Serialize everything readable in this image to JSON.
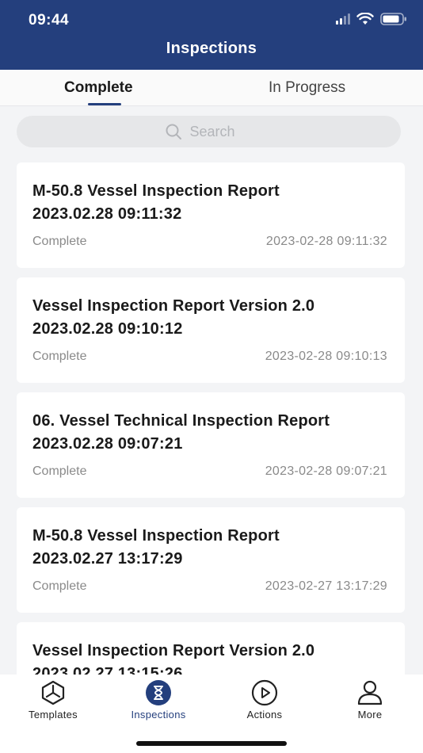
{
  "status_bar": {
    "time": "09:44"
  },
  "header": {
    "title": "Inspections"
  },
  "tabs": [
    {
      "label": "Complete",
      "active": true
    },
    {
      "label": "In Progress",
      "active": false
    }
  ],
  "search": {
    "placeholder": "Search"
  },
  "inspections": [
    {
      "title_line1": "M-50.8 Vessel Inspection Report",
      "title_line2": "2023.02.28 09:11:32",
      "status": "Complete",
      "date": "2023-02-28 09:11:32"
    },
    {
      "title_line1": "Vessel Inspection Report Version 2.0",
      "title_line2": "2023.02.28 09:10:12",
      "status": "Complete",
      "date": "2023-02-28 09:10:13"
    },
    {
      "title_line1": "06. Vessel Technical Inspection Report",
      "title_line2": "2023.02.28 09:07:21",
      "status": "Complete",
      "date": "2023-02-28 09:07:21"
    },
    {
      "title_line1": "M-50.8 Vessel Inspection Report",
      "title_line2": "2023.02.27 13:17:29",
      "status": "Complete",
      "date": "2023-02-27 13:17:29"
    },
    {
      "title_line1": "Vessel Inspection Report Version 2.0",
      "title_line2": "2023.02.27 13:15:26",
      "status": "",
      "date": ""
    }
  ],
  "bottom_nav": [
    {
      "label": "Templates",
      "icon": "templates-icon",
      "active": false
    },
    {
      "label": "Inspections",
      "icon": "hourglass-icon",
      "active": true
    },
    {
      "label": "Actions",
      "icon": "play-circle-icon",
      "active": false
    },
    {
      "label": "More",
      "icon": "person-icon",
      "active": false
    }
  ],
  "colors": {
    "brand": "#243f7d",
    "background": "#f3f4f6",
    "muted_text": "#8a8a8a"
  }
}
